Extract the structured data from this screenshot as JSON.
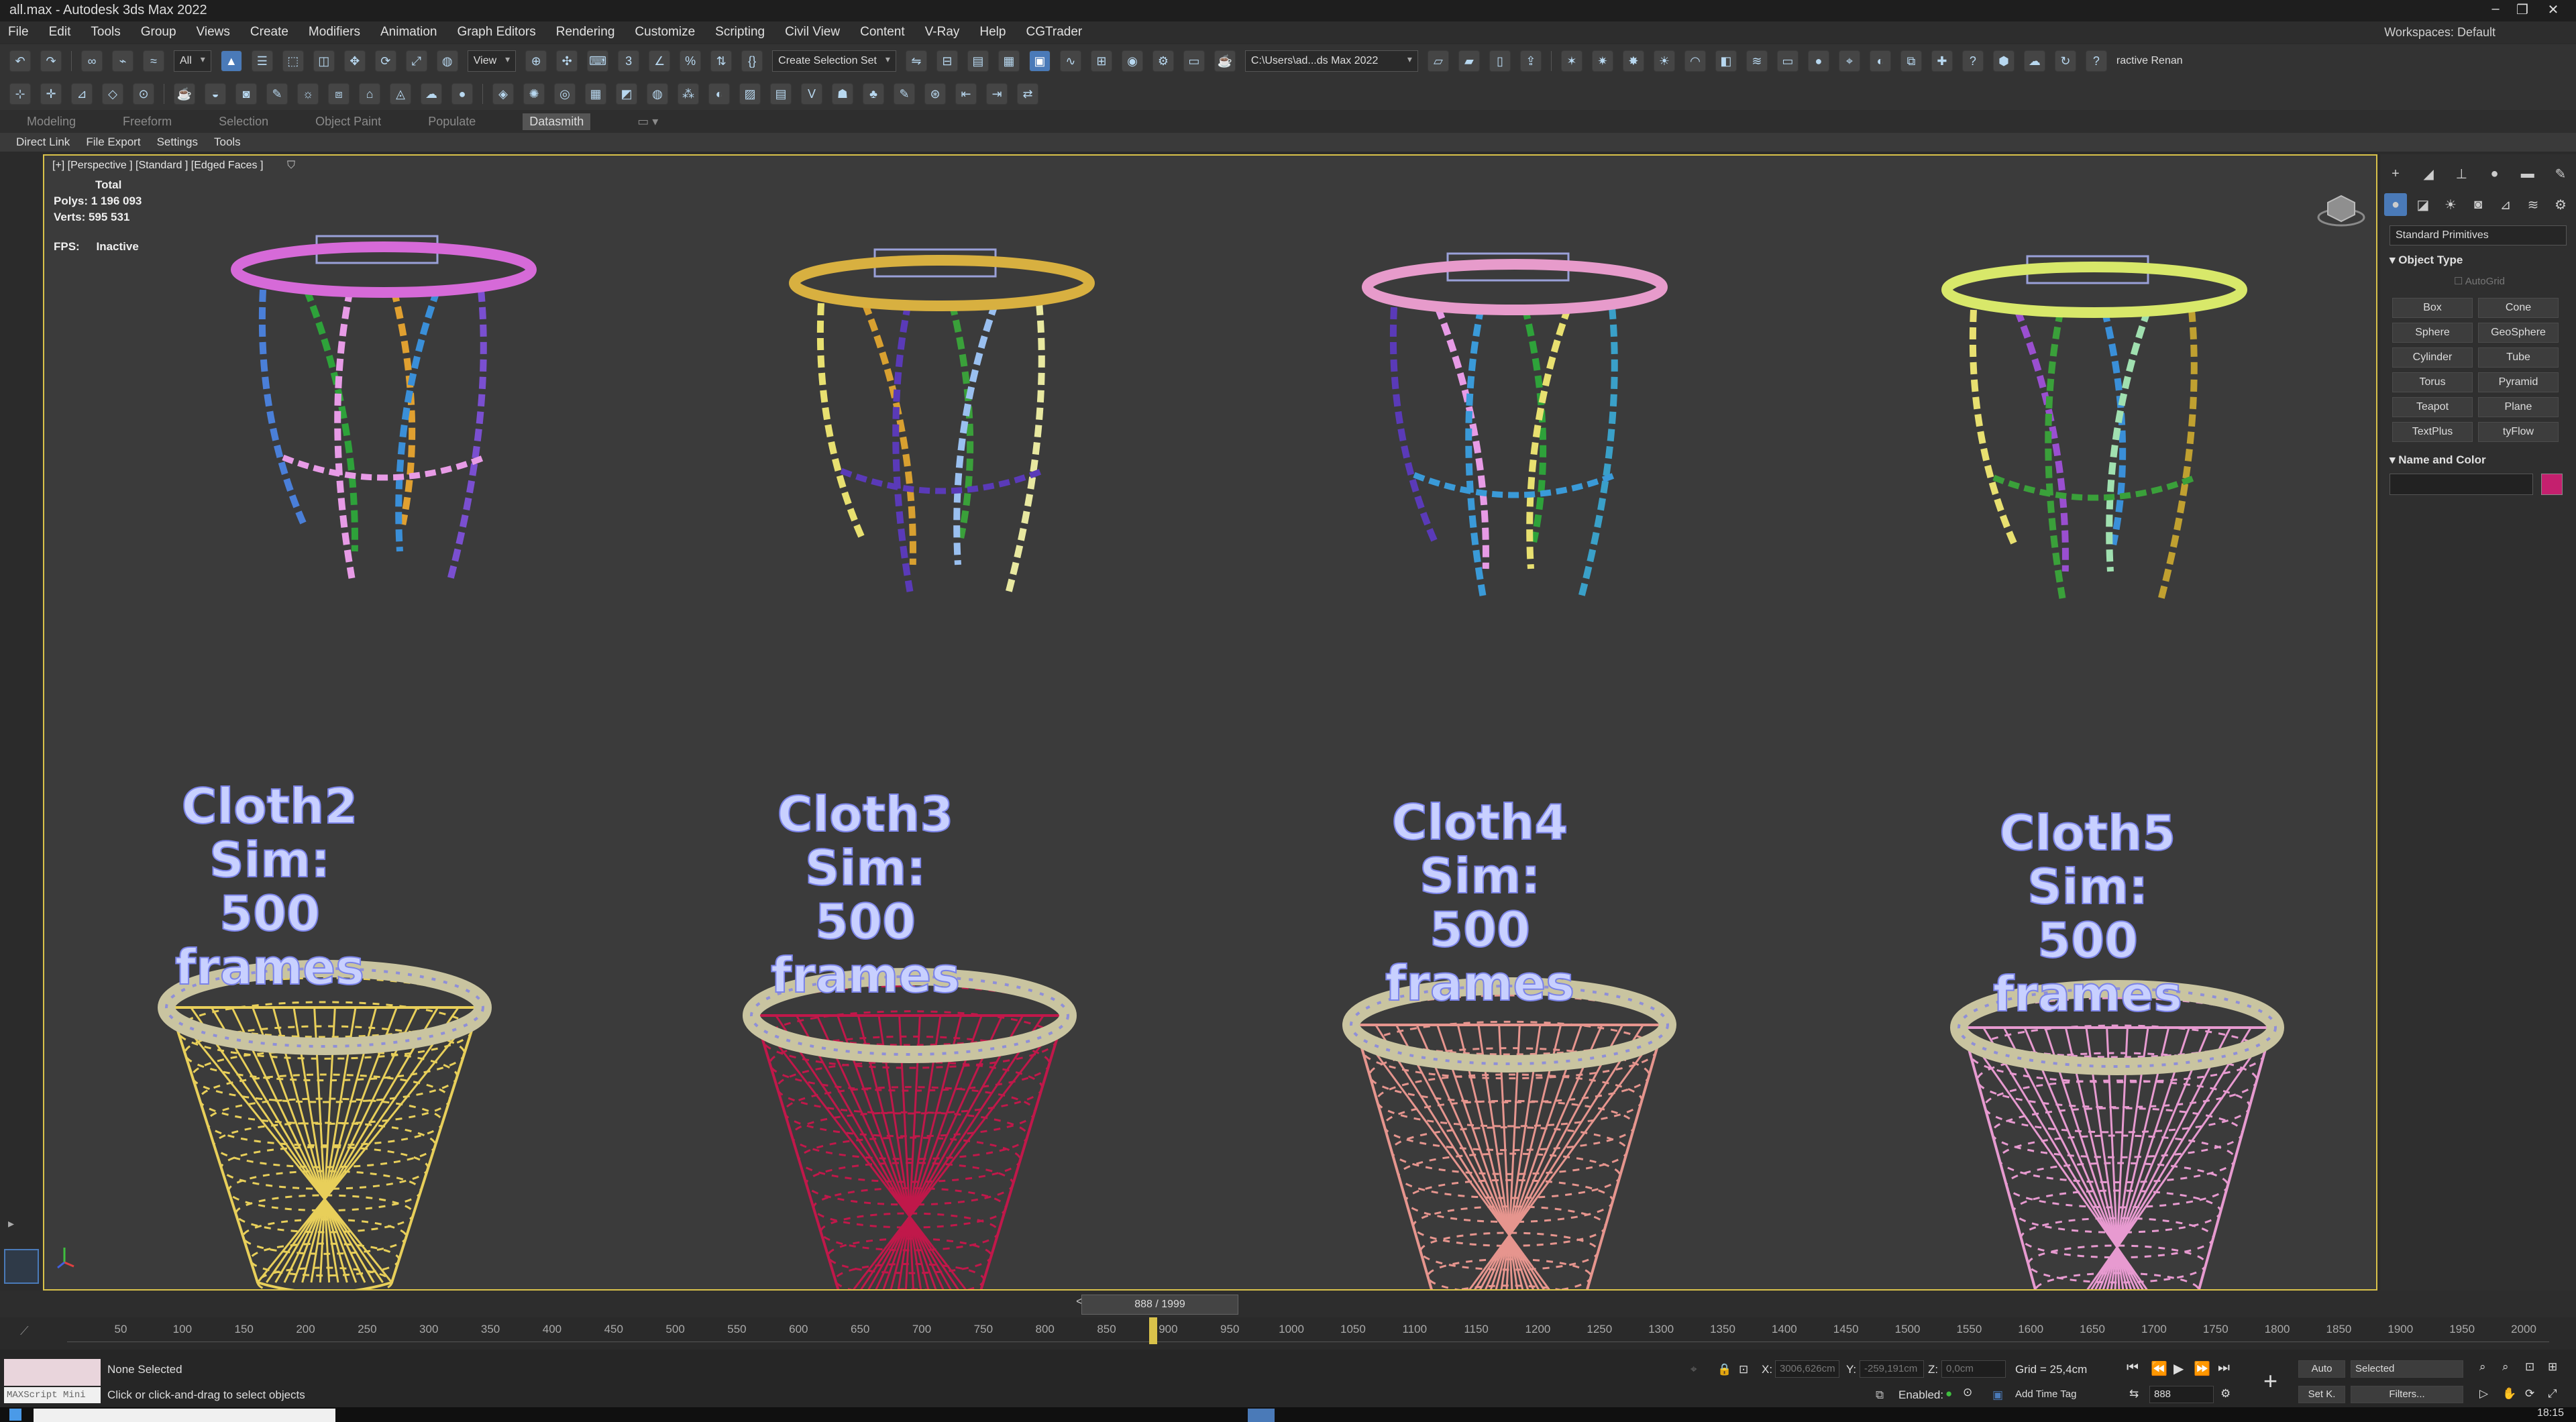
{
  "window": {
    "title": "all.max - Autodesk 3ds Max 2022",
    "min_glyph": "–",
    "max_glyph": "❐",
    "close_glyph": "✕"
  },
  "menu": [
    "File",
    "Edit",
    "Tools",
    "Group",
    "Views",
    "Create",
    "Modifiers",
    "Animation",
    "Graph Editors",
    "Rendering",
    "Customize",
    "Scripting",
    "Civil View",
    "Content",
    "V-Ray",
    "Help",
    "CGTrader"
  ],
  "workspaces": {
    "label": "Workspaces:",
    "value": "Default"
  },
  "toolbar": {
    "filter_value": "All",
    "view_value": "View",
    "selection_set_placeholder": "Create Selection Set",
    "path_value": "C:\\Users\\ad...ds Max 2022",
    "interactive_label": "ractive Renan"
  },
  "ribbon": {
    "tabs": [
      "Modeling",
      "Freeform",
      "Selection",
      "Object Paint",
      "Populate",
      "Datasmith"
    ],
    "active_tab": "Datasmith",
    "subtabs": [
      "Direct Link",
      "File Export",
      "Settings",
      "Tools"
    ]
  },
  "viewport": {
    "label": "[+] [Perspective ] [Standard ] [Edged Faces ]",
    "stats_header": "Total",
    "polys": "Polys:  1 196 093",
    "verts": "Verts:   595 531",
    "fps_label": "FPS:",
    "fps_value": "Inactive",
    "sims": [
      {
        "line1": "Cloth2 Sim:",
        "line2": "500 frames",
        "net_color": "#e8cf5a"
      },
      {
        "line1": "Cloth3 Sim:",
        "line2": "500 frames",
        "net_color": "#c0184a"
      },
      {
        "line1": "Cloth4 Sim:",
        "line2": "500 frames",
        "net_color": "#e6958e"
      },
      {
        "line1": "Cloth5 Sim:",
        "line2": "500 frames",
        "net_color": "#e79ad0"
      }
    ],
    "chain_hoops": [
      {
        "rim_color": "#d66ad8",
        "chains": [
          "#4a7fd8",
          "#2ea23a",
          "#e79be6",
          "#e0a030",
          "#3a8fd8",
          "#7a4fd0"
        ]
      },
      {
        "rim_color": "#d8b040",
        "chains": [
          "#e8e070",
          "#d8a030",
          "#5a3ab8",
          "#3aa03a",
          "#9ac0f0",
          "#e8e8a0"
        ]
      },
      {
        "rim_color": "#e79bcb",
        "chains": [
          "#5a3ab8",
          "#e79be6",
          "#3a9ad8",
          "#2ea23a",
          "#e8e070",
          "#3aa0c8"
        ]
      },
      {
        "rim_color": "#d8e86a",
        "chains": [
          "#e8e070",
          "#9a4fd0",
          "#3aa03a",
          "#3a8fd8",
          "#a0e0b0",
          "#c0a030"
        ]
      }
    ]
  },
  "command_panel": {
    "dropdown": "Standard Primitives",
    "object_type": "Object Type",
    "autogrid": "AutoGrid",
    "buttons": [
      "Box",
      "Cone",
      "Sphere",
      "GeoSphere",
      "Cylinder",
      "Tube",
      "Torus",
      "Pyramid",
      "Teapot",
      "Plane",
      "TextPlus",
      "tyFlow"
    ],
    "name_and_color": "Name and Color",
    "color": "#c4206e"
  },
  "timeline": {
    "slider": "888 / 1999",
    "current_frame": 888,
    "max_frame": 1999,
    "ticks": [
      "50",
      "100",
      "150",
      "200",
      "250",
      "300",
      "350",
      "400",
      "450",
      "500",
      "550",
      "600",
      "650",
      "700",
      "750",
      "800",
      "850",
      "900",
      "950",
      "1000",
      "1050",
      "1100",
      "1150",
      "1200",
      "1250",
      "1300",
      "1350",
      "1400",
      "1450",
      "1500",
      "1550",
      "1600",
      "1650",
      "1700",
      "1750",
      "1800",
      "1850",
      "1900",
      "1950",
      "2000"
    ]
  },
  "status": {
    "selection": "None Selected",
    "prompt": "Click or click-and-drag to select objects",
    "maxscript": "MAXScript Mini",
    "x_label": "X:",
    "x_value": "3006,626cm",
    "y_label": "Y:",
    "y_value": "-259,191cm",
    "z_label": "Z:",
    "z_value": "0,0cm",
    "grid": "Grid = 25,4cm",
    "enabled": "Enabled:",
    "add_time_tag": "Add Time Tag",
    "auto": "Auto",
    "selected": "Selected",
    "set_key": "Set K.",
    "filters": "Filters...",
    "frame": "888",
    "clock": "18:15"
  }
}
